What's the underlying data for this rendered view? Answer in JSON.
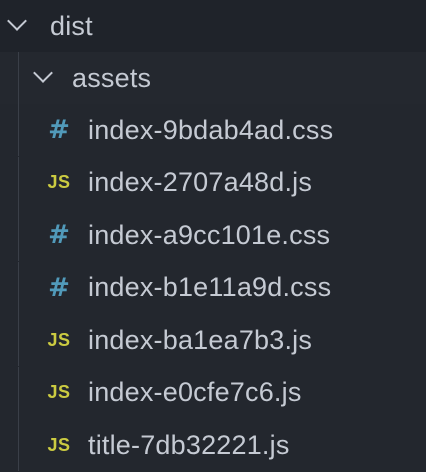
{
  "explorer": {
    "root_folder": {
      "name": "dist",
      "expanded": true,
      "chevron_icon": "chevron-down-icon"
    },
    "sub_folder": {
      "name": "assets",
      "expanded": true,
      "chevron_icon": "chevron-down-icon"
    },
    "files": [
      {
        "name": "index-9bdab4ad.css",
        "type": "css",
        "icon": "css-hash-icon",
        "icon_text": "#"
      },
      {
        "name": "index-2707a48d.js",
        "type": "js",
        "icon": "js-icon",
        "icon_text": "JS"
      },
      {
        "name": "index-a9cc101e.css",
        "type": "css",
        "icon": "css-hash-icon",
        "icon_text": "#"
      },
      {
        "name": "index-b1e11a9d.css",
        "type": "css",
        "icon": "css-hash-icon",
        "icon_text": "#"
      },
      {
        "name": "index-ba1ea7b3.js",
        "type": "js",
        "icon": "js-icon",
        "icon_text": "JS"
      },
      {
        "name": "index-e0cfe7c6.js",
        "type": "js",
        "icon": "js-icon",
        "icon_text": "JS"
      },
      {
        "name": "title-7db32221.js",
        "type": "js",
        "icon": "js-icon",
        "icon_text": "JS"
      }
    ],
    "colors": {
      "background": "#23272e",
      "text": "#c5cad3",
      "css_icon": "#519aba",
      "js_icon": "#cbcb41"
    }
  }
}
